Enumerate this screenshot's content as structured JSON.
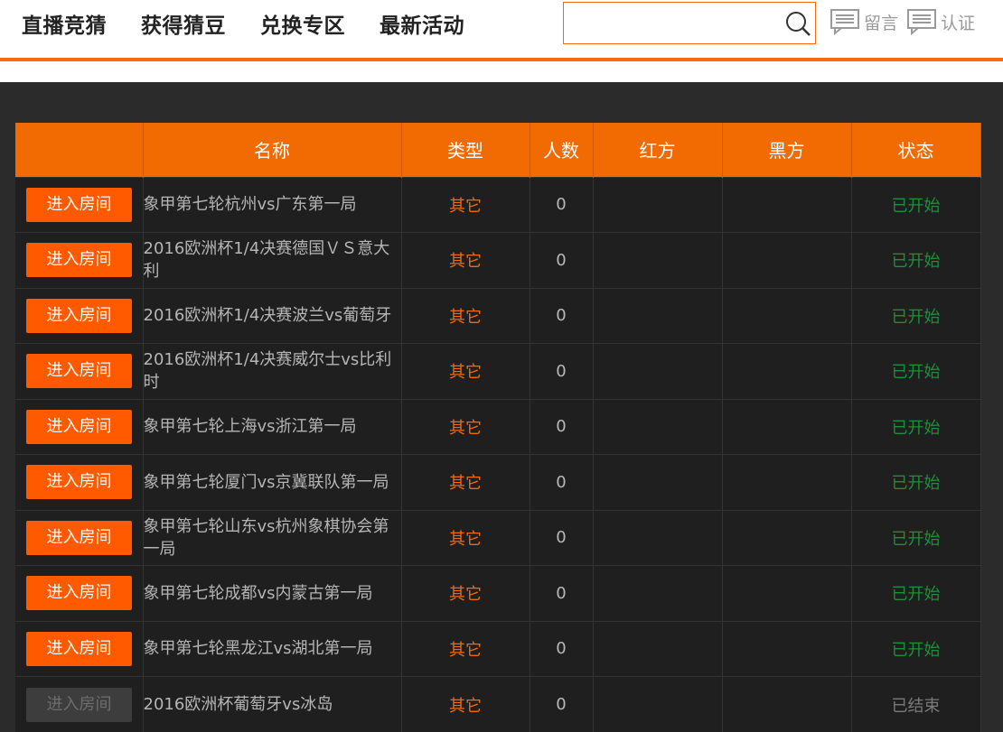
{
  "nav": {
    "items": [
      "直播竞猜",
      "获得猜豆",
      "兑换专区",
      "最新活动"
    ]
  },
  "search": {
    "placeholder": "",
    "value": ""
  },
  "header_links": {
    "message": "留言",
    "certify": "认证"
  },
  "colors": {
    "accent": "#f26a12",
    "status_started": "#1f8f3a",
    "background": "#2b2b2b"
  },
  "table": {
    "headers": [
      "",
      "名称",
      "类型",
      "人数",
      "红方",
      "黑方",
      "状态"
    ],
    "rows": [
      {
        "button": "进入房间",
        "name": "象甲第七轮杭州vs广东第一局",
        "type": "其它",
        "count": "0",
        "red": "",
        "black": "",
        "status": "已开始"
      },
      {
        "button": "进入房间",
        "name": "2016欧洲杯1/4决赛德国ＶＳ意大利",
        "type": "其它",
        "count": "0",
        "red": "",
        "black": "",
        "status": "已开始"
      },
      {
        "button": "进入房间",
        "name": "2016欧洲杯1/4决赛波兰vs葡萄牙",
        "type": "其它",
        "count": "0",
        "red": "",
        "black": "",
        "status": "已开始"
      },
      {
        "button": "进入房间",
        "name": "2016欧洲杯1/4决赛威尔士vs比利时",
        "type": "其它",
        "count": "0",
        "red": "",
        "black": "",
        "status": "已开始"
      },
      {
        "button": "进入房间",
        "name": "象甲第七轮上海vs浙江第一局",
        "type": "其它",
        "count": "0",
        "red": "",
        "black": "",
        "status": "已开始"
      },
      {
        "button": "进入房间",
        "name": "象甲第七轮厦门vs京冀联队第一局",
        "type": "其它",
        "count": "0",
        "red": "",
        "black": "",
        "status": "已开始"
      },
      {
        "button": "进入房间",
        "name": "象甲第七轮山东vs杭州象棋协会第一局",
        "type": "其它",
        "count": "0",
        "red": "",
        "black": "",
        "status": "已开始"
      },
      {
        "button": "进入房间",
        "name": "象甲第七轮成都vs内蒙古第一局",
        "type": "其它",
        "count": "0",
        "red": "",
        "black": "",
        "status": "已开始"
      },
      {
        "button": "进入房间",
        "name": "象甲第七轮黑龙江vs湖北第一局",
        "type": "其它",
        "count": "0",
        "red": "",
        "black": "",
        "status": "已开始"
      },
      {
        "button": "进入房间",
        "name": "2016欧洲杯葡萄牙vs冰岛",
        "type": "其它",
        "count": "0",
        "red": "",
        "black": "",
        "status": "已结束",
        "disabled": true
      }
    ]
  }
}
